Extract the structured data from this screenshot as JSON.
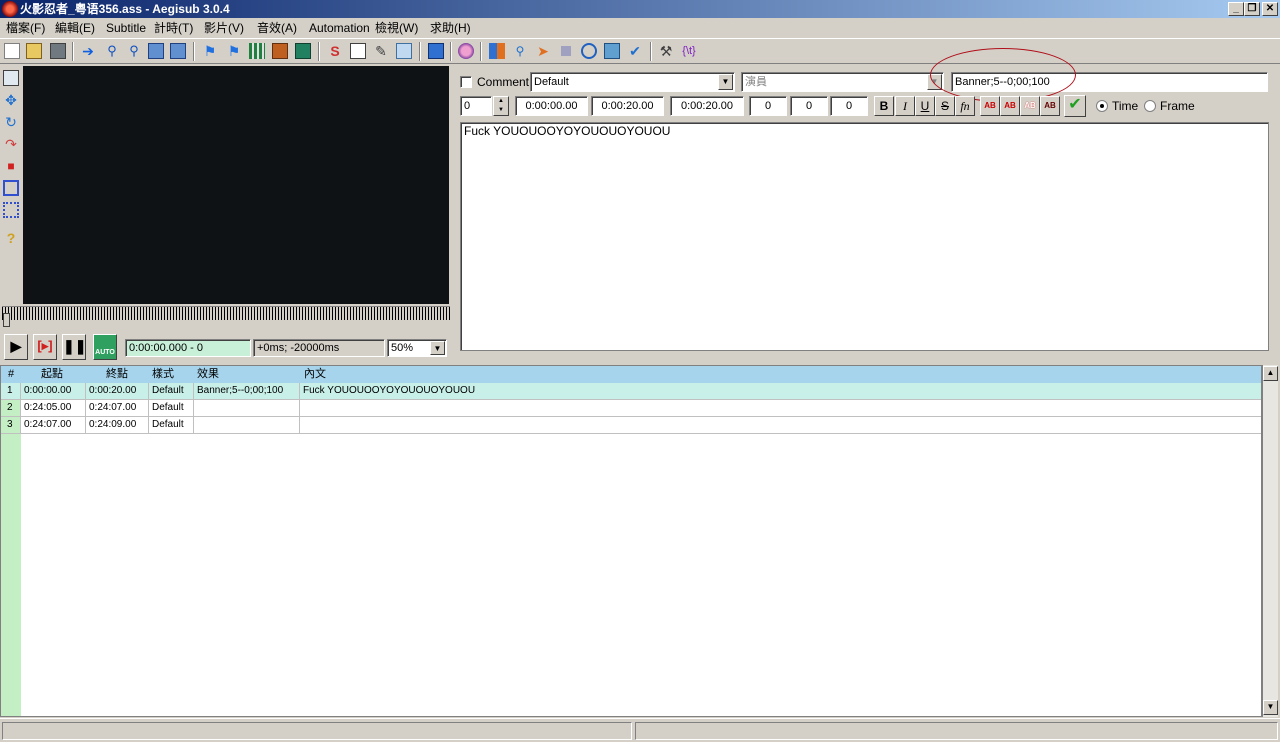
{
  "window": {
    "title": "火影忍者_粤语356.ass - Aegisub 3.0.4",
    "minimize": "_",
    "restore": "❐",
    "close": "✕"
  },
  "menu": [
    "檔案(F)",
    "編輯(E)",
    "Subtitle",
    "計時(T)",
    "影片(V)",
    "音效(A)",
    "Automation",
    "檢視(W)",
    "求助(H)"
  ],
  "toolbar_icons": [
    "new-file-icon",
    "open-file-icon",
    "save-icon",
    "jump-icon",
    "zoom-in-icon",
    "zoom-out-icon",
    "snapshot-icon",
    "copy-snapshot-icon",
    "time-icon",
    "time-end-icon",
    "keyframe-icon",
    "video-icon",
    "detach-video-icon",
    "styles-icon",
    "properties-icon",
    "attachments-icon",
    "fonts-icon",
    "automation-icon",
    "karaoke-icon",
    "shift-times-icon",
    "translation-icon",
    "resample-icon",
    "timing-post-icon",
    "kanji-timer-icon",
    "spell-check-icon",
    "options-icon",
    "tag-toggle-icon"
  ],
  "video": {
    "time_display": "0:00:00.000 - 0",
    "offset_display": "+0ms; -20000ms",
    "zoom": "50%",
    "auto_label": "AUTO"
  },
  "edit": {
    "comment_label": "Comment",
    "style": "Default",
    "actor_placeholder": "演員",
    "effect": "Banner;5--0;00;100",
    "layer": "0",
    "start_time": "0:00:00.00",
    "end_time": "0:00:20.00",
    "duration": "0:00:20.00",
    "margin_l": "0",
    "margin_r": "0",
    "margin_v": "0",
    "bold": "B",
    "italic": "I",
    "underline": "U",
    "strike": "S",
    "font": "fn",
    "color_label": "AB",
    "time_label": "Time",
    "frame_label": "Frame",
    "text": "Fuck YOUOUOOYOYOUOUOYOUOU"
  },
  "grid": {
    "headers": [
      "#",
      "起點",
      "終點",
      "樣式",
      "效果",
      "內文"
    ],
    "rows": [
      {
        "num": "1",
        "start": "0:00:00.00",
        "end": "0:00:20.00",
        "style": "Default",
        "effect": "Banner;5--0;00;100",
        "text": "Fuck YOUOUOOYOYOUOUOYOUOU"
      },
      {
        "num": "2",
        "start": "0:24:05.00",
        "end": "0:24:07.00",
        "style": "Default",
        "effect": "",
        "text": ""
      },
      {
        "num": "3",
        "start": "0:24:07.00",
        "end": "0:24:09.00",
        "style": "Default",
        "effect": "",
        "text": ""
      }
    ]
  },
  "colors": {
    "selected_row": "#c8f0e8",
    "grid_header": "#a6d4ec",
    "annotation_circle": "#b0101a"
  }
}
